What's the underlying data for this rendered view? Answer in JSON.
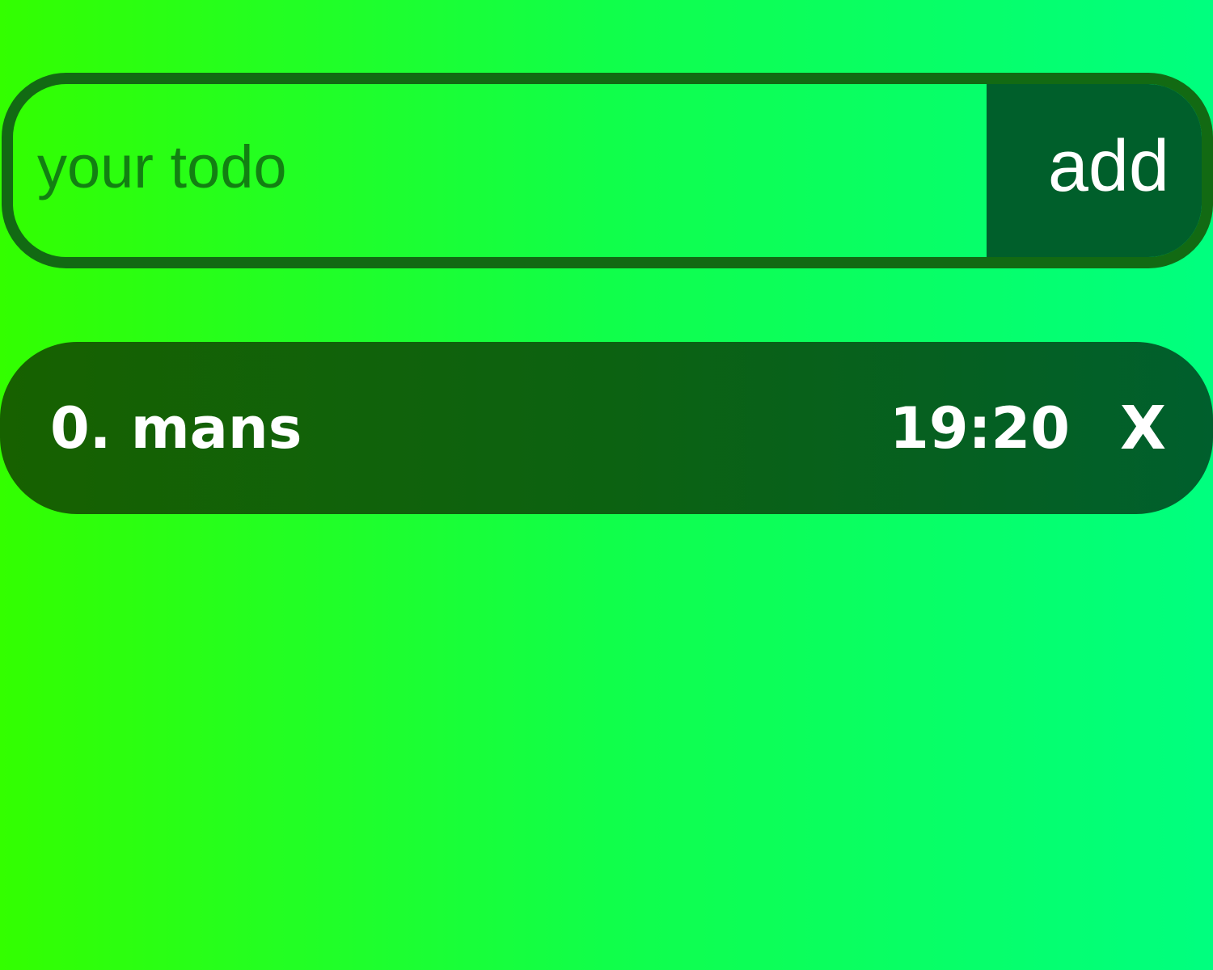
{
  "todo_form": {
    "input_placeholder": "your todo",
    "input_value": "",
    "add_label": "add"
  },
  "todos": [
    {
      "index_label": "0.",
      "text": "mans",
      "time": "19:20",
      "delete_label": "X"
    }
  ],
  "colors": {
    "background_start": "#33ff00",
    "background_end": "#00ff7f",
    "form_border": "#126a13",
    "add_button": "#005f2b",
    "item_start": "#176100",
    "item_end": "#005f2d",
    "text_light": "#ffffff",
    "placeholder": "#128012"
  }
}
